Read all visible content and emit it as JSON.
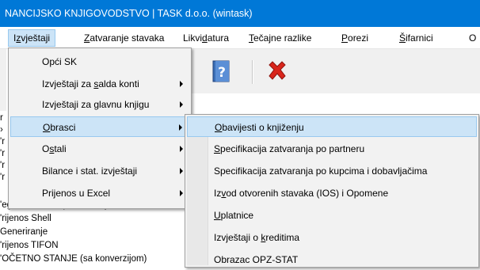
{
  "window": {
    "title": "NANCIJSKO KNJIGOVODSTVO  |  TASK d.o.o. (wintask)"
  },
  "menubar": [
    {
      "pre": "I",
      "u": "z",
      "post": "vještaji"
    },
    {
      "pre": "",
      "u": "Z",
      "post": "atvaranje stavaka"
    },
    {
      "pre": "Likvi",
      "u": "d",
      "post": "atura"
    },
    {
      "pre": "",
      "u": "T",
      "post": "ečajne razlike"
    },
    {
      "pre": "",
      "u": "P",
      "post": "orezi"
    },
    {
      "pre": "",
      "u": "Š",
      "post": "ifarnici"
    },
    {
      "pre": "O",
      "u": "",
      "post": ""
    }
  ],
  "menu": {
    "items": [
      {
        "pre": "Opći SK",
        "u": "",
        "post": ""
      },
      {
        "pre": "Izvještaji za ",
        "u": "s",
        "post": "alda konti"
      },
      {
        "pre": "Izvještaji za ",
        "u": "g",
        "post": "lavnu knjigu"
      },
      {
        "pre": "",
        "u": "O",
        "post": "brasci"
      },
      {
        "pre": "O",
        "u": "s",
        "post": "tali"
      },
      {
        "pre": "Bilance i stat. izvještaji",
        "u": "",
        "post": ""
      },
      {
        "pre": "Prijenos u Excel",
        "u": "",
        "post": ""
      }
    ]
  },
  "submenu": {
    "items": [
      {
        "pre": "",
        "u": "O",
        "post": "bavijesti o knjiženju"
      },
      {
        "pre": "",
        "u": "S",
        "post": "pecifikacija zatvaranja po partneru"
      },
      {
        "pre": "Specifikacija zatvaranja po kupcima i dobavljačima",
        "u": "",
        "post": ""
      },
      {
        "pre": "Iz",
        "u": "v",
        "post": "od otvorenih stavaka (IOS) i Opomene"
      },
      {
        "pre": "",
        "u": "U",
        "post": "platnice"
      },
      {
        "pre": "Izvještaji o ",
        "u": "k",
        "post": "reditima"
      },
      {
        "pre": "Obrazac OPZ-STAT",
        "u": "",
        "post": ""
      }
    ]
  },
  "background_list": [
    "r",
    "›",
    "'r",
    "'r",
    "'r",
    "'r",
    "'egled obveza i potraživanja",
    "'rijenos Shell",
    "Generiranje",
    "'rijenos TIFON",
    "'OČETNO STANJE (sa konverzijom)"
  ],
  "toolbar_icons": [
    "help-icon",
    "delete-icon"
  ]
}
